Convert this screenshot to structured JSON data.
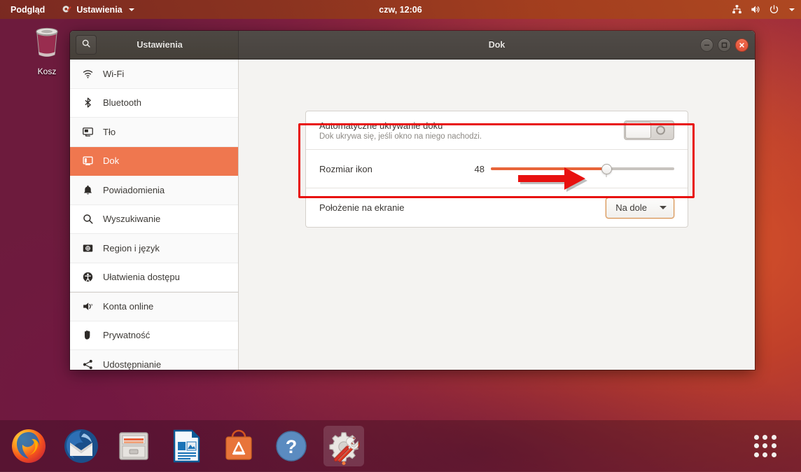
{
  "top_panel": {
    "left_item": "Podgląd",
    "app_menu": "Ustawienia",
    "app_icon": "settings-gear-wrench-icon",
    "clock": "czw, 12:06",
    "indicators": [
      "network-icon",
      "volume-icon",
      "power-icon",
      "chevron-down-icon"
    ]
  },
  "desktop": {
    "trash_label": "Kosz",
    "trash_icon": "trash-icon"
  },
  "window": {
    "sidebar_title": "Ustawienia",
    "content_title": "Dok",
    "search_icon": "search-icon",
    "controls": {
      "minimize": "minimize-button",
      "maximize": "maximize-button",
      "close": "close-button"
    },
    "sidebar_items": [
      {
        "label": "Wi-Fi",
        "icon": "wifi-icon",
        "active": false
      },
      {
        "label": "Bluetooth",
        "icon": "bluetooth-icon",
        "active": false
      },
      {
        "label": "Tło",
        "icon": "background-monitor-icon",
        "active": false
      },
      {
        "label": "Dok",
        "icon": "dock-icon",
        "active": true
      },
      {
        "label": "Powiadomienia",
        "icon": "bell-icon",
        "active": false
      },
      {
        "label": "Wyszukiwanie",
        "icon": "search-icon",
        "active": false
      },
      {
        "label": "Region i język",
        "icon": "region-language-icon",
        "active": false
      },
      {
        "label": "Ułatwienia dostępu",
        "icon": "accessibility-icon",
        "active": false
      },
      {
        "label": "Konta online",
        "icon": "online-accounts-icon",
        "active": false
      },
      {
        "label": "Prywatność",
        "icon": "privacy-hand-icon",
        "active": false
      },
      {
        "label": "Udostępnianie",
        "icon": "sharing-icon",
        "active": false
      }
    ],
    "settings": {
      "autohide": {
        "title": "Automatyczne ukrywanie doku",
        "subtitle": "Dok ukrywa się, jeśli okno na niego nachodzi.",
        "toggle_state": "off"
      },
      "icon_size": {
        "title": "Rozmiar ikon",
        "value": "48",
        "slider_percent": 63
      },
      "position": {
        "title": "Położenie na ekranie",
        "selected": "Na dole",
        "dropdown_arrow": "chevron-down-icon"
      }
    }
  },
  "annotations": {
    "highlight_color": "#e8110f",
    "arrow_color": "#e8110f",
    "arrow_target": "position-dropdown"
  },
  "dock": {
    "items": [
      {
        "name": "firefox",
        "icon": "firefox-icon",
        "active": false
      },
      {
        "name": "thunderbird",
        "icon": "thunderbird-icon",
        "active": false
      },
      {
        "name": "files",
        "icon": "files-cabinet-icon",
        "active": false
      },
      {
        "name": "libreoffice-writer",
        "icon": "writer-document-icon",
        "active": false
      },
      {
        "name": "ubuntu-software",
        "icon": "software-bag-icon",
        "active": false
      },
      {
        "name": "help",
        "icon": "help-question-icon",
        "active": false
      },
      {
        "name": "settings",
        "icon": "settings-gear-wrench-icon",
        "active": true
      }
    ],
    "show_apps": "apps-grid-icon"
  }
}
